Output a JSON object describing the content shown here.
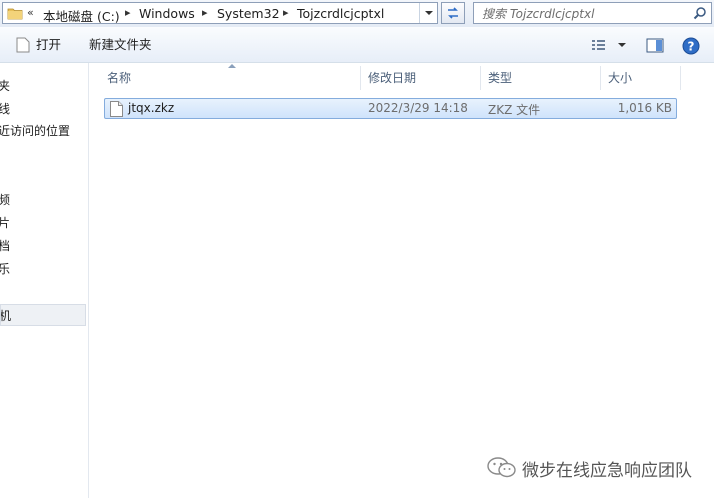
{
  "address_bar": {
    "overflow_chevron": "«",
    "crumbs": [
      "本地磁盘 (C:)",
      "Windows",
      "System32",
      "Tojzcrdlcjcptxl"
    ],
    "separator": "▸"
  },
  "search": {
    "placeholder": "搜索 Tojzcrdlcjcptxl"
  },
  "toolbar": {
    "open_label": "打开",
    "new_folder_label": "新建文件夹"
  },
  "nav": {
    "items": [
      "夹",
      "线",
      "近访问的位置",
      "频",
      "片",
      "档",
      "乐",
      "机"
    ],
    "selected_index": 7
  },
  "columns": {
    "name": "名称",
    "modified": "修改日期",
    "type": "类型",
    "size": "大小"
  },
  "files": [
    {
      "name": "jtqx.zkz",
      "modified": "2022/3/29 14:18",
      "type": "ZKZ 文件",
      "size": "1,016 KB"
    }
  ],
  "watermark": {
    "text": "微步在线应急响应团队"
  },
  "colors": {
    "selection_border": "#84acdd",
    "header_text": "#4c607a",
    "help_blue": "#2f6dc6"
  }
}
